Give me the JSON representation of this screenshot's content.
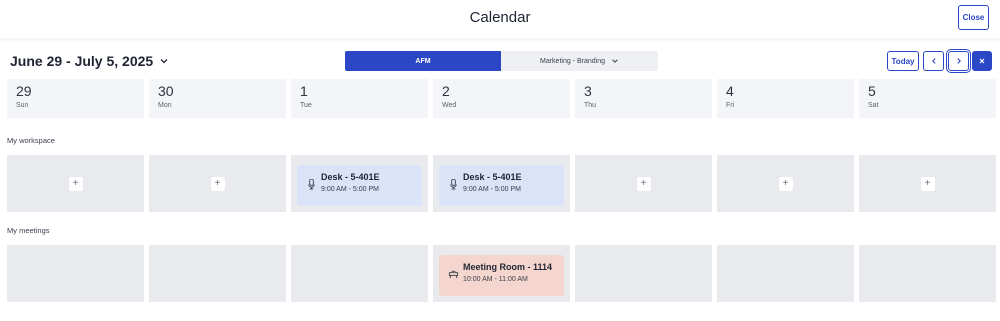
{
  "header": {
    "title": "Calendar",
    "close_label": "Close"
  },
  "toolbar": {
    "date_range": "June 29 - July 5, 2025",
    "segment_active": "AFM",
    "segment_other": "Marketing - Branding",
    "today_label": "Today"
  },
  "days": [
    {
      "num": "29",
      "name": "Sun"
    },
    {
      "num": "30",
      "name": "Mon"
    },
    {
      "num": "1",
      "name": "Tue"
    },
    {
      "num": "2",
      "name": "Wed"
    },
    {
      "num": "3",
      "name": "Thu"
    },
    {
      "num": "4",
      "name": "Fri"
    },
    {
      "num": "5",
      "name": "Sat"
    }
  ],
  "workspace": {
    "label": "My workspace",
    "add_glyph": "+",
    "bookings": [
      {
        "title": "Desk - 5-401E",
        "time": "9:00 AM - 5:00 PM",
        "icon": "desk-icon"
      },
      {
        "title": "Desk - 5-401E",
        "time": "9:00 AM - 5:00 PM",
        "icon": "desk-icon"
      }
    ]
  },
  "meetings": {
    "label": "My meetings",
    "bookings": [
      {
        "title": "Meeting Room - 1114",
        "time": "10:00 AM - 11:00 AM",
        "icon": "meeting-room-icon"
      }
    ]
  },
  "colors": {
    "accent": "#2c47c6",
    "desk_booking": "#dbe3f8",
    "room_booking": "#f5d6ce",
    "cell": "#e9eaee"
  }
}
